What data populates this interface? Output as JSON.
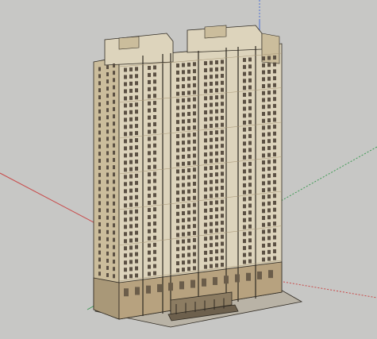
{
  "viewport": {
    "background": "#c7c7c5",
    "view": "perspective",
    "visible_axes": [
      "red",
      "green",
      "blue"
    ]
  },
  "model": {
    "type": "high-rise residential tower model",
    "towers": 2,
    "podium_entrance": true,
    "colors": {
      "facade_light": "#ddd4bc",
      "facade_mid": "#cbbd9c",
      "facade_shadow": "#a99878",
      "window": "#5b5043",
      "base": "#b7a27f",
      "edge": "#2f2a22"
    }
  },
  "axes": {
    "red": "#c84b4b",
    "green": "#3f9b55",
    "blue": "#4b6fd2"
  }
}
